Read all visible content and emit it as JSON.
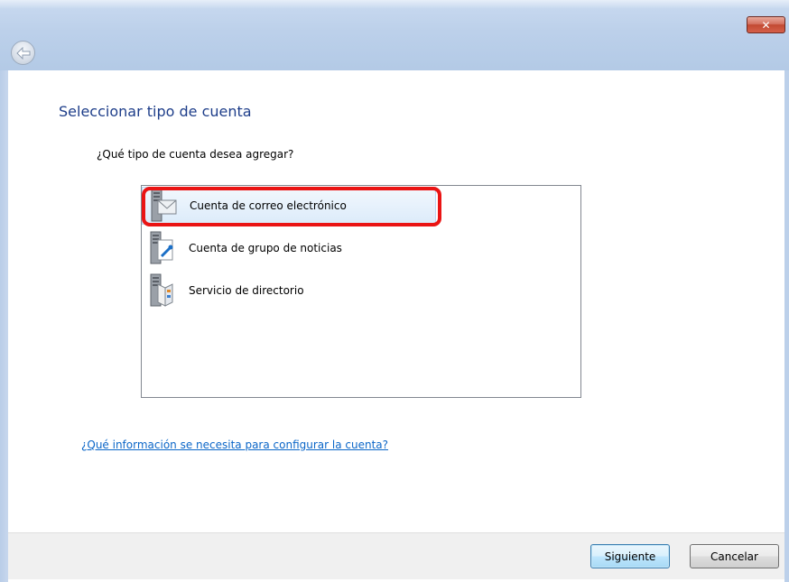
{
  "window": {
    "close_label": "✕"
  },
  "page": {
    "title": "Seleccionar tipo de cuenta",
    "question": "¿Qué tipo de cuenta desea agregar?"
  },
  "account_types": [
    {
      "label": "Cuenta de correo electrónico",
      "icon": "mail-server-icon",
      "selected": true
    },
    {
      "label": "Cuenta de grupo de noticias",
      "icon": "news-server-icon",
      "selected": false
    },
    {
      "label": "Servicio de directorio",
      "icon": "directory-server-icon",
      "selected": false
    }
  ],
  "help_link": "¿Qué información se necesita para configurar la cuenta?",
  "buttons": {
    "next": "Siguiente",
    "cancel": "Cancelar"
  },
  "colors": {
    "title": "#1e3e8a",
    "link": "#0b66c8",
    "highlight_outline": "#ea1414",
    "frame": "#bcd0ea"
  }
}
